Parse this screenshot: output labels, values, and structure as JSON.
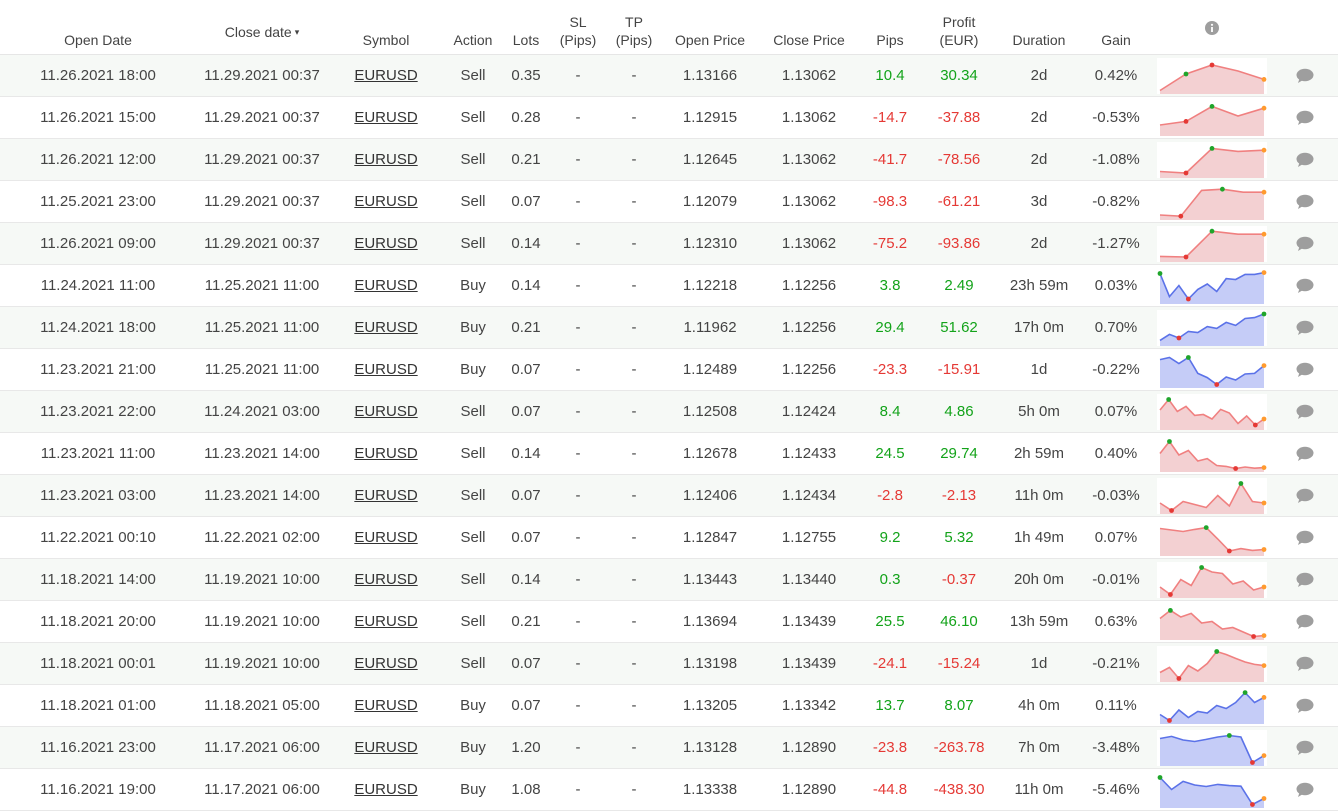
{
  "headers": {
    "open_date": "Open Date",
    "close_date": "Close date",
    "sort_arrow": "▾",
    "symbol": "Symbol",
    "action": "Action",
    "lots": "Lots",
    "sl_1": "SL",
    "sl_2": "(Pips)",
    "tp_1": "TP",
    "tp_2": "(Pips)",
    "open_price": "Open Price",
    "close_price": "Close Price",
    "pips": "Pips",
    "profit_1": "Profit",
    "profit_2": "(EUR)",
    "duration": "Duration",
    "gain": "Gain",
    "info_icon": "info-icon"
  },
  "colors": {
    "positive": "#13a31a",
    "negative": "#e53935",
    "sell_line": "#f08080",
    "sell_fill": "#f3d0d2",
    "buy_line": "#5b72e8",
    "buy_fill": "#c5ccf7",
    "start_marker": "#1fa52b",
    "low_marker": "#e53935",
    "end_marker": "#ff9a2e"
  },
  "trades": [
    {
      "open": "11.26.2021 18:00",
      "close": "11.29.2021 00:37",
      "symbol": "EURUSD",
      "action": "Sell",
      "lots": "0.35",
      "sl": "-",
      "tp": "-",
      "open_price": "1.13166",
      "close_price": "1.13062",
      "pips": "10.4",
      "profit": "30.34",
      "duration": "2d",
      "gain": "0.42%",
      "spark": [
        0.05,
        0.6,
        0.9,
        0.7,
        0.42
      ],
      "spark_markers": {
        "hi": 1,
        "lo": 2,
        "end": 4
      }
    },
    {
      "open": "11.26.2021 15:00",
      "close": "11.29.2021 00:37",
      "symbol": "EURUSD",
      "action": "Sell",
      "lots": "0.28",
      "sl": "-",
      "tp": "-",
      "open_price": "1.12915",
      "close_price": "1.13062",
      "pips": "-14.7",
      "profit": "-37.88",
      "duration": "2d",
      "gain": "-0.53%",
      "spark": [
        0.3,
        0.42,
        0.92,
        0.6,
        0.86
      ],
      "spark_markers": {
        "hi": 2,
        "lo": 1,
        "end": 4
      }
    },
    {
      "open": "11.26.2021 12:00",
      "close": "11.29.2021 00:37",
      "symbol": "EURUSD",
      "action": "Sell",
      "lots": "0.21",
      "sl": "-",
      "tp": "-",
      "open_price": "1.12645",
      "close_price": "1.13062",
      "pips": "-41.7",
      "profit": "-78.56",
      "duration": "2d",
      "gain": "-1.08%",
      "spark": [
        0.15,
        0.1,
        0.92,
        0.82,
        0.86
      ],
      "spark_markers": {
        "hi": 2,
        "lo": 1,
        "end": 4
      }
    },
    {
      "open": "11.25.2021 23:00",
      "close": "11.29.2021 00:37",
      "symbol": "EURUSD",
      "action": "Sell",
      "lots": "0.07",
      "sl": "-",
      "tp": "-",
      "open_price": "1.12079",
      "close_price": "1.13062",
      "pips": "-98.3",
      "profit": "-61.21",
      "duration": "3d",
      "gain": "-0.82%",
      "spark": [
        0.1,
        0.06,
        0.92,
        0.96,
        0.86,
        0.86
      ],
      "spark_markers": {
        "hi": 3,
        "lo": 1,
        "end": 5
      }
    },
    {
      "open": "11.26.2021 09:00",
      "close": "11.29.2021 00:37",
      "symbol": "EURUSD",
      "action": "Sell",
      "lots": "0.14",
      "sl": "-",
      "tp": "-",
      "open_price": "1.12310",
      "close_price": "1.13062",
      "pips": "-75.2",
      "profit": "-93.86",
      "duration": "2d",
      "gain": "-1.27%",
      "spark": [
        0.12,
        0.1,
        0.96,
        0.86,
        0.86
      ],
      "spark_markers": {
        "hi": 2,
        "lo": 1,
        "end": 4
      }
    },
    {
      "open": "11.24.2021 11:00",
      "close": "11.25.2021 11:00",
      "symbol": "EURUSD",
      "action": "Buy",
      "lots": "0.14",
      "sl": "-",
      "tp": "-",
      "open_price": "1.12218",
      "close_price": "1.12256",
      "pips": "3.8",
      "profit": "2.49",
      "duration": "23h 59m",
      "gain": "0.03%",
      "spark": [
        0.95,
        0.18,
        0.55,
        0.1,
        0.42,
        0.6,
        0.35,
        0.78,
        0.75,
        0.92,
        0.92,
        0.98
      ],
      "spark_markers": {
        "hi": 0,
        "lo": 3,
        "end": 11
      }
    },
    {
      "open": "11.24.2021 18:00",
      "close": "11.25.2021 11:00",
      "symbol": "EURUSD",
      "action": "Buy",
      "lots": "0.21",
      "sl": "-",
      "tp": "-",
      "open_price": "1.11962",
      "close_price": "1.12256",
      "pips": "29.4",
      "profit": "51.62",
      "duration": "17h 0m",
      "gain": "0.70%",
      "spark": [
        0.12,
        0.32,
        0.2,
        0.42,
        0.38,
        0.58,
        0.52,
        0.72,
        0.62,
        0.85,
        0.88,
        1.0
      ],
      "spark_markers": {
        "hi": 11,
        "lo": 2,
        "end": 11,
        "end_green": true
      }
    },
    {
      "open": "11.23.2021 21:00",
      "close": "11.25.2021 11:00",
      "symbol": "EURUSD",
      "action": "Buy",
      "lots": "0.07",
      "sl": "-",
      "tp": "-",
      "open_price": "1.12489",
      "close_price": "1.12256",
      "pips": "-23.3",
      "profit": "-15.91",
      "duration": "1d",
      "gain": "-0.22%",
      "spark": [
        0.88,
        0.95,
        0.75,
        0.95,
        0.42,
        0.28,
        0.05,
        0.3,
        0.2,
        0.4,
        0.42,
        0.68
      ],
      "spark_markers": {
        "hi": 3,
        "lo": 6,
        "end": 11
      }
    },
    {
      "open": "11.23.2021 22:00",
      "close": "11.24.2021 03:00",
      "symbol": "EURUSD",
      "action": "Sell",
      "lots": "0.07",
      "sl": "-",
      "tp": "-",
      "open_price": "1.12508",
      "close_price": "1.12424",
      "pips": "8.4",
      "profit": "4.86",
      "duration": "5h 0m",
      "gain": "0.07%",
      "spark": [
        0.6,
        0.95,
        0.55,
        0.72,
        0.42,
        0.45,
        0.3,
        0.62,
        0.5,
        0.15,
        0.4,
        0.1,
        0.3
      ],
      "spark_markers": {
        "hi": 1,
        "lo": 11,
        "end": 12
      }
    },
    {
      "open": "11.23.2021 11:00",
      "close": "11.23.2021 14:00",
      "symbol": "EURUSD",
      "action": "Sell",
      "lots": "0.14",
      "sl": "-",
      "tp": "-",
      "open_price": "1.12678",
      "close_price": "1.12433",
      "pips": "24.5",
      "profit": "29.74",
      "duration": "2h 59m",
      "gain": "0.40%",
      "spark": [
        0.55,
        0.95,
        0.5,
        0.65,
        0.3,
        0.38,
        0.15,
        0.12,
        0.05,
        0.1,
        0.06,
        0.08
      ],
      "spark_markers": {
        "hi": 1,
        "lo": 8,
        "end": 11
      }
    },
    {
      "open": "11.23.2021 03:00",
      "close": "11.23.2021 14:00",
      "symbol": "EURUSD",
      "action": "Sell",
      "lots": "0.07",
      "sl": "-",
      "tp": "-",
      "open_price": "1.12406",
      "close_price": "1.12434",
      "pips": "-2.8",
      "profit": "-2.13",
      "duration": "11h 0m",
      "gain": "-0.03%",
      "spark": [
        0.3,
        0.05,
        0.35,
        0.25,
        0.15,
        0.55,
        0.2,
        0.95,
        0.35,
        0.3
      ],
      "spark_markers": {
        "hi": 7,
        "lo": 1,
        "end": 9
      }
    },
    {
      "open": "11.22.2021 00:10",
      "close": "11.22.2021 02:00",
      "symbol": "EURUSD",
      "action": "Sell",
      "lots": "0.07",
      "sl": "-",
      "tp": "-",
      "open_price": "1.12847",
      "close_price": "1.12755",
      "pips": "9.2",
      "profit": "5.32",
      "duration": "1h 49m",
      "gain": "0.07%",
      "spark": [
        0.85,
        0.8,
        0.75,
        0.82,
        0.88,
        0.5,
        0.1,
        0.18,
        0.12,
        0.15
      ],
      "spark_markers": {
        "hi": 4,
        "lo": 6,
        "end": 9
      }
    },
    {
      "open": "11.18.2021 14:00",
      "close": "11.19.2021 10:00",
      "symbol": "EURUSD",
      "action": "Sell",
      "lots": "0.14",
      "sl": "-",
      "tp": "-",
      "open_price": "1.13443",
      "close_price": "1.13440",
      "pips": "0.3",
      "profit": "-0.37",
      "duration": "20h 0m",
      "gain": "-0.01%",
      "spark": [
        0.3,
        0.05,
        0.55,
        0.35,
        0.95,
        0.8,
        0.75,
        0.4,
        0.5,
        0.2,
        0.3
      ],
      "spark_markers": {
        "hi": 4,
        "lo": 1,
        "end": 10
      }
    },
    {
      "open": "11.18.2021 20:00",
      "close": "11.19.2021 10:00",
      "symbol": "EURUSD",
      "action": "Sell",
      "lots": "0.21",
      "sl": "-",
      "tp": "-",
      "open_price": "1.13694",
      "close_price": "1.13439",
      "pips": "25.5",
      "profit": "46.10",
      "duration": "13h 59m",
      "gain": "0.63%",
      "spark": [
        0.65,
        0.92,
        0.7,
        0.82,
        0.5,
        0.55,
        0.3,
        0.35,
        0.2,
        0.05,
        0.08
      ],
      "spark_markers": {
        "hi": 1,
        "lo": 9,
        "end": 10
      }
    },
    {
      "open": "11.18.2021 00:01",
      "close": "11.19.2021 10:00",
      "symbol": "EURUSD",
      "action": "Sell",
      "lots": "0.07",
      "sl": "-",
      "tp": "-",
      "open_price": "1.13198",
      "close_price": "1.13439",
      "pips": "-24.1",
      "profit": "-15.24",
      "duration": "1d",
      "gain": "-0.21%",
      "spark": [
        0.25,
        0.42,
        0.05,
        0.48,
        0.3,
        0.55,
        0.95,
        0.85,
        0.72,
        0.6,
        0.52,
        0.48
      ],
      "spark_markers": {
        "hi": 6,
        "lo": 2,
        "end": 11
      }
    },
    {
      "open": "11.18.2021 01:00",
      "close": "11.18.2021 05:00",
      "symbol": "EURUSD",
      "action": "Buy",
      "lots": "0.07",
      "sl": "-",
      "tp": "-",
      "open_price": "1.13205",
      "close_price": "1.13342",
      "pips": "13.7",
      "profit": "8.07",
      "duration": "4h 0m",
      "gain": "0.11%",
      "spark": [
        0.25,
        0.05,
        0.4,
        0.15,
        0.35,
        0.3,
        0.55,
        0.45,
        0.65,
        0.98,
        0.65,
        0.82
      ],
      "spark_markers": {
        "hi": 9,
        "lo": 1,
        "end": 11
      }
    },
    {
      "open": "11.16.2021 23:00",
      "close": "11.17.2021 06:00",
      "symbol": "EURUSD",
      "action": "Buy",
      "lots": "1.20",
      "sl": "-",
      "tp": "-",
      "open_price": "1.13128",
      "close_price": "1.12890",
      "pips": "-23.8",
      "profit": "-263.78",
      "duration": "7h 0m",
      "gain": "-3.48%",
      "spark": [
        0.85,
        0.92,
        0.8,
        0.75,
        0.82,
        0.9,
        0.95,
        0.9,
        0.05,
        0.28
      ],
      "spark_markers": {
        "hi": 6,
        "lo": 8,
        "end": 9
      }
    },
    {
      "open": "11.16.2021 19:00",
      "close": "11.17.2021 06:00",
      "symbol": "EURUSD",
      "action": "Buy",
      "lots": "1.08",
      "sl": "-",
      "tp": "-",
      "open_price": "1.13338",
      "close_price": "1.12890",
      "pips": "-44.8",
      "profit": "-438.30",
      "duration": "11h 0m",
      "gain": "-5.46%",
      "spark": [
        0.95,
        0.55,
        0.82,
        0.7,
        0.65,
        0.72,
        0.68,
        0.66,
        0.05,
        0.25
      ],
      "spark_markers": {
        "hi": 0,
        "lo": 8,
        "end": 9
      }
    }
  ]
}
